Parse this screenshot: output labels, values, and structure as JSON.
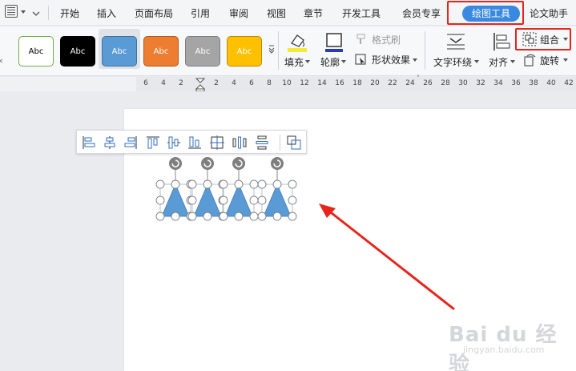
{
  "tabs": [
    "开始",
    "插入",
    "页面布局",
    "引用",
    "审阅",
    "视图",
    "章节",
    "开发工具",
    "会员专享",
    "绘图工具",
    "论文助手"
  ],
  "active_tab": "绘图工具",
  "style_presets": [
    {
      "label": "Abc",
      "bg": "#ffffff",
      "fg": "#000000",
      "border": "#70ad47"
    },
    {
      "label": "Abc",
      "bg": "#000000",
      "fg": "#ffffff",
      "border": "#000000"
    },
    {
      "label": "Abc",
      "bg": "#5b9bd5",
      "fg": "#ffffff",
      "border": "#41719c"
    },
    {
      "label": "Abc",
      "bg": "#ed7d31",
      "fg": "#ffffff",
      "border": "#ae5a21"
    },
    {
      "label": "Abc",
      "bg": "#a5a5a5",
      "fg": "#ffffff",
      "border": "#7f7f7f"
    },
    {
      "label": "Abc",
      "bg": "#ffc000",
      "fg": "#ffffff",
      "border": "#bc8c00"
    }
  ],
  "ribbon": {
    "fill_label": "填充",
    "outline_label": "轮廓",
    "format_painter_label": "格式刷",
    "shape_effects_label": "形状效果",
    "text_wrap_label": "文字环绕",
    "align_label": "对齐",
    "group_label": "组合",
    "rotate_label": "旋转"
  },
  "ruler_ticks": [
    "6",
    "4",
    "2",
    "2",
    "4",
    "6",
    "8",
    "10",
    "12",
    "14",
    "16",
    "18",
    "20",
    "22",
    "24",
    "26",
    "28",
    "30",
    "32",
    "34",
    "36",
    "38",
    "40",
    "42"
  ],
  "watermark": {
    "main": "Bai du 经验",
    "sub": "jingyan.baidu.com"
  },
  "colors": {
    "accent": "#3a89e0",
    "annotation": "#e8241c",
    "shape_fill": "#5b9bd5",
    "handle": "#7f7f7f"
  }
}
